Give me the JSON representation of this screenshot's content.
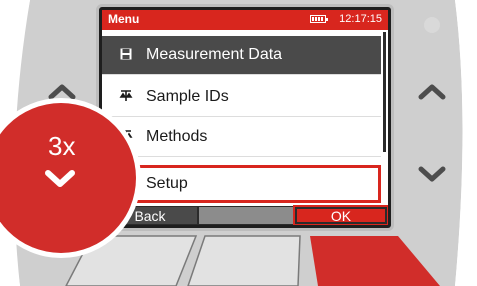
{
  "titlebar": {
    "title": "Menu",
    "clock": "12:17:15",
    "battery_icon": "battery-icon"
  },
  "menu": {
    "items": [
      {
        "label": "Measurement Data",
        "icon": "floppy-disk-icon",
        "glyph": "🖫",
        "state": "selected"
      },
      {
        "label": "Sample IDs",
        "icon": "sample-tube-icon",
        "glyph": "⚗",
        "state": "normal"
      },
      {
        "label": "Methods",
        "icon": "methods-icon",
        "glyph": "⚗",
        "state": "normal"
      },
      {
        "label": "Setup",
        "icon": "setup-wrench-icon",
        "glyph": "ƒ",
        "state": "outlined"
      }
    ],
    "scroll_position": 0.0
  },
  "softkeys": {
    "left": "Back",
    "middle": "",
    "right": "OK"
  },
  "overlay": {
    "press_count": "3x",
    "direction_icon": "chevron-down-icon"
  },
  "colors": {
    "brand_red": "#d8261e",
    "screen_dark": "#2b2b2b",
    "selected_row": "#4a4a4a",
    "device_body": "#c9c9c9"
  }
}
